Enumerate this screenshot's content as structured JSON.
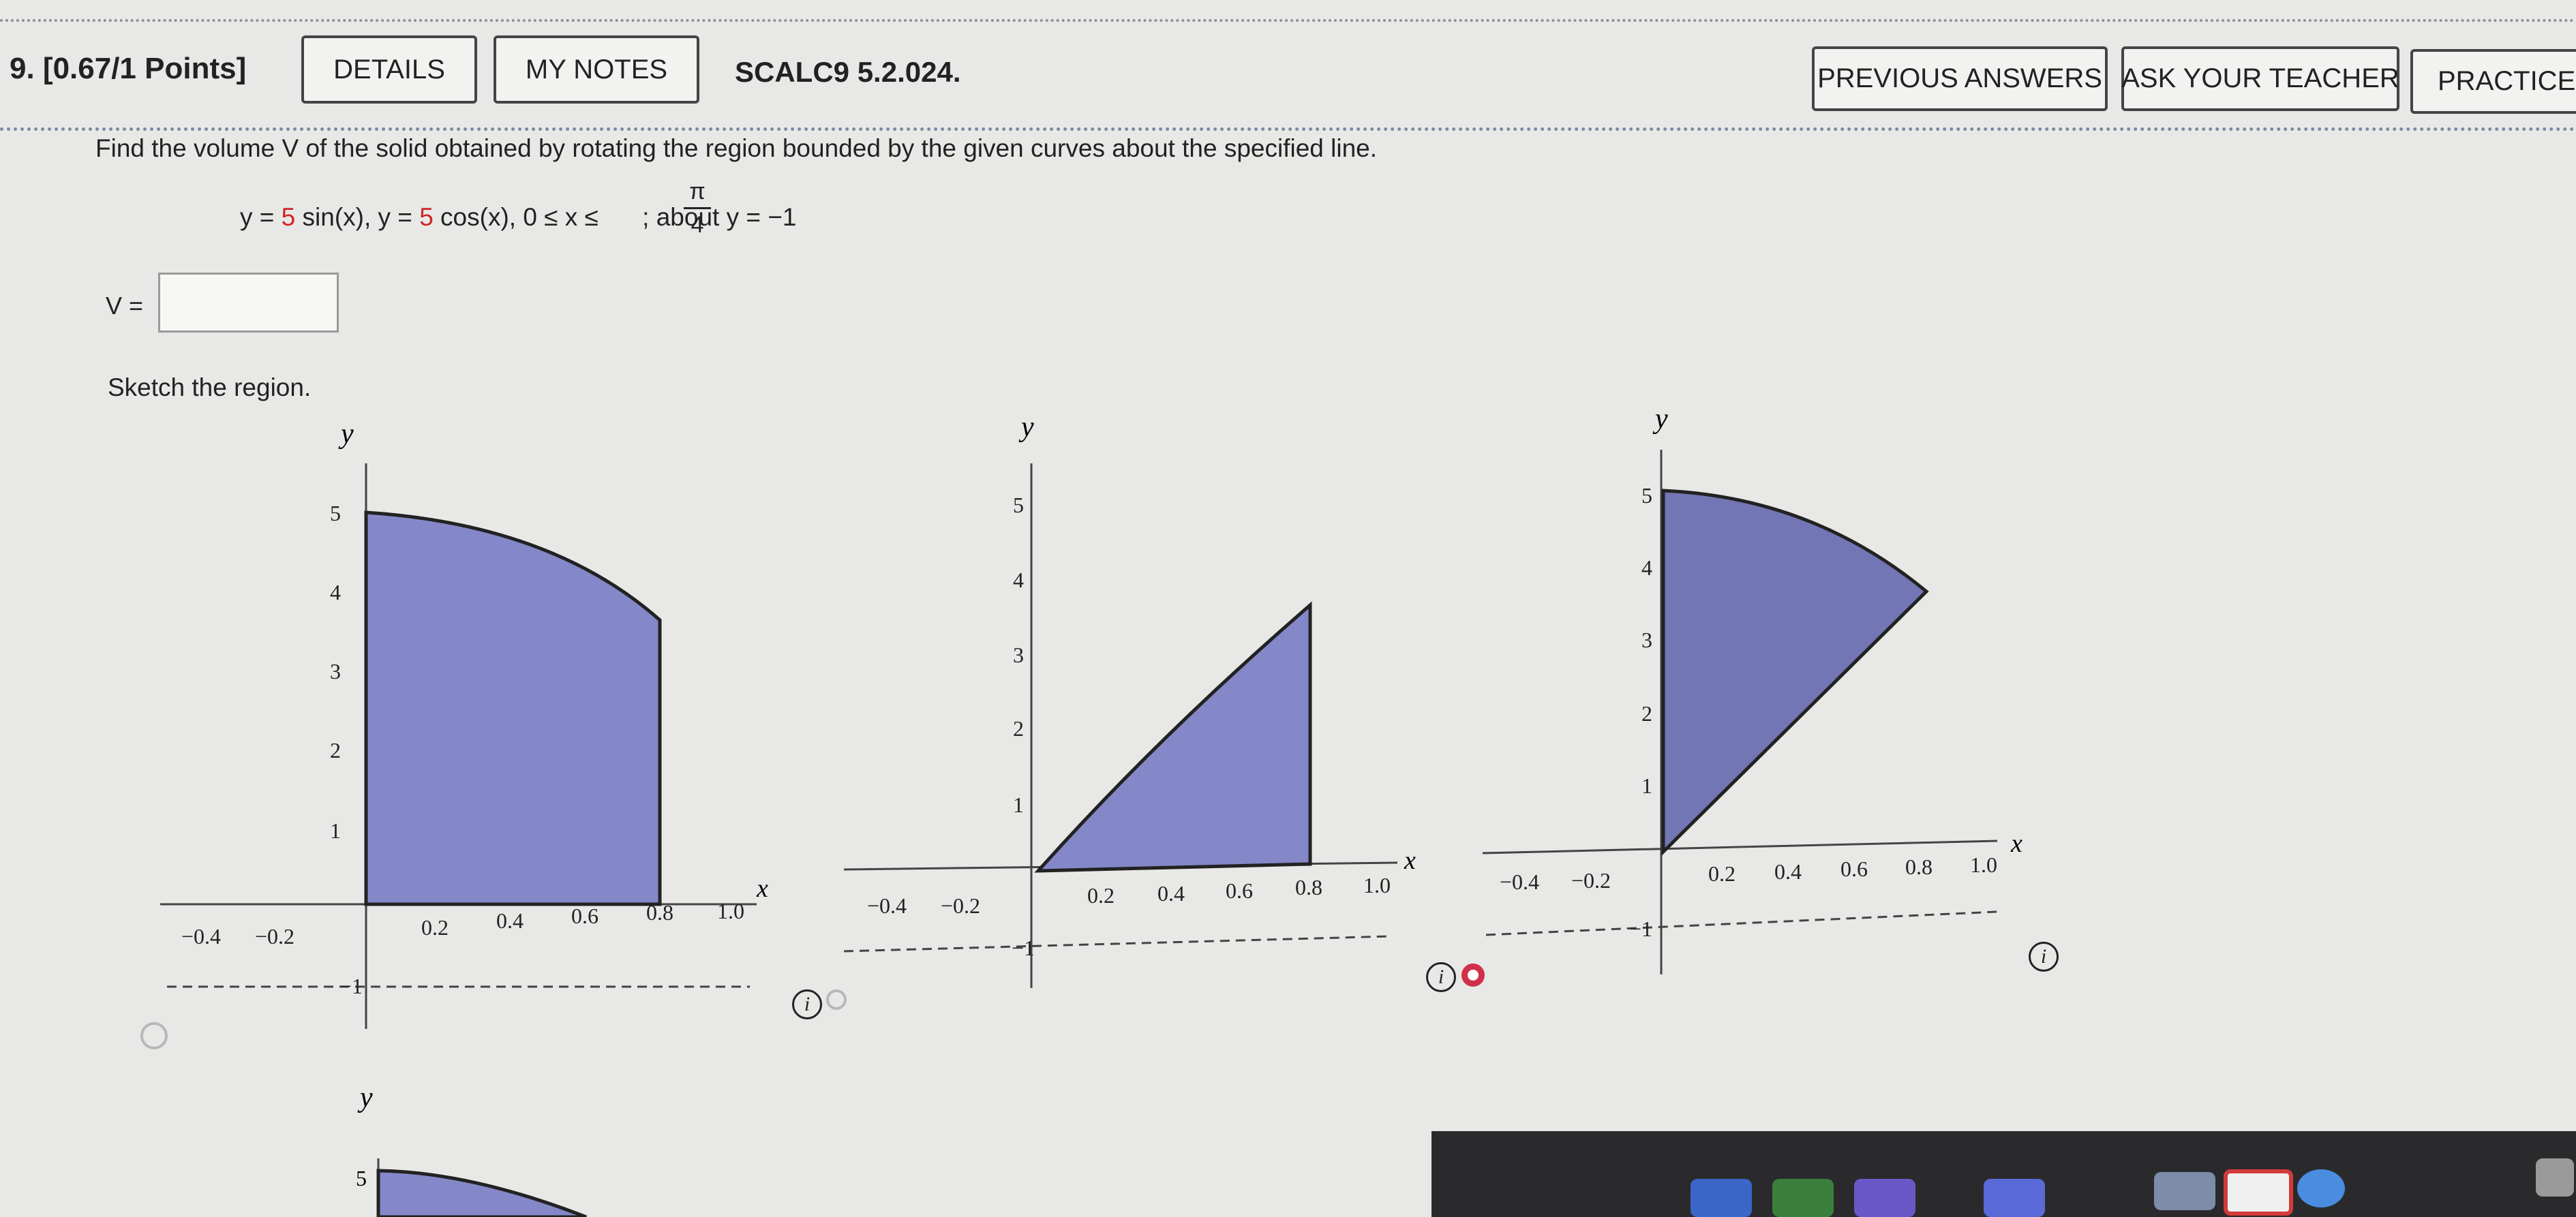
{
  "header": {
    "question_number": "9. [0.67/1 Points]",
    "details_label": "DETAILS",
    "my_notes_label": "MY NOTES",
    "problem_code": "SCALC9 5.2.024.",
    "previous_answers_label": "PREVIOUS ANSWERS",
    "ask_teacher_label": "ASK YOUR TEACHER",
    "practice_label": "PRACTICE AN"
  },
  "problem": {
    "prompt": "Find the volume V of the solid obtained by rotating the region bounded by the given curves about the specified line.",
    "eq_y1": "y = ",
    "eq_c1": "5",
    "eq_f1": " sin(x),  y = ",
    "eq_c2": "5",
    "eq_f2": " cos(x),  0 ≤ x ≤ ",
    "frac_num": "π",
    "frac_den": "4",
    "eq_tail": ";   about y = −1",
    "volume_label": "V =",
    "volume_value": "",
    "sketch_label": "Sketch the region."
  },
  "graphs": {
    "y_label": "y",
    "x_label": "x",
    "y_ticks": [
      "1",
      "2",
      "3",
      "4",
      "5"
    ],
    "neg_tick": "−1",
    "x_ticks": [
      "−0.4",
      "−0.2",
      "0.2",
      "0.4",
      "0.6",
      "0.8",
      "1.0"
    ],
    "info_glyph": "i"
  },
  "colors": {
    "region_fill": "#8488c8",
    "answer_red": "#d02525",
    "selected_radio": "#d0304a"
  }
}
